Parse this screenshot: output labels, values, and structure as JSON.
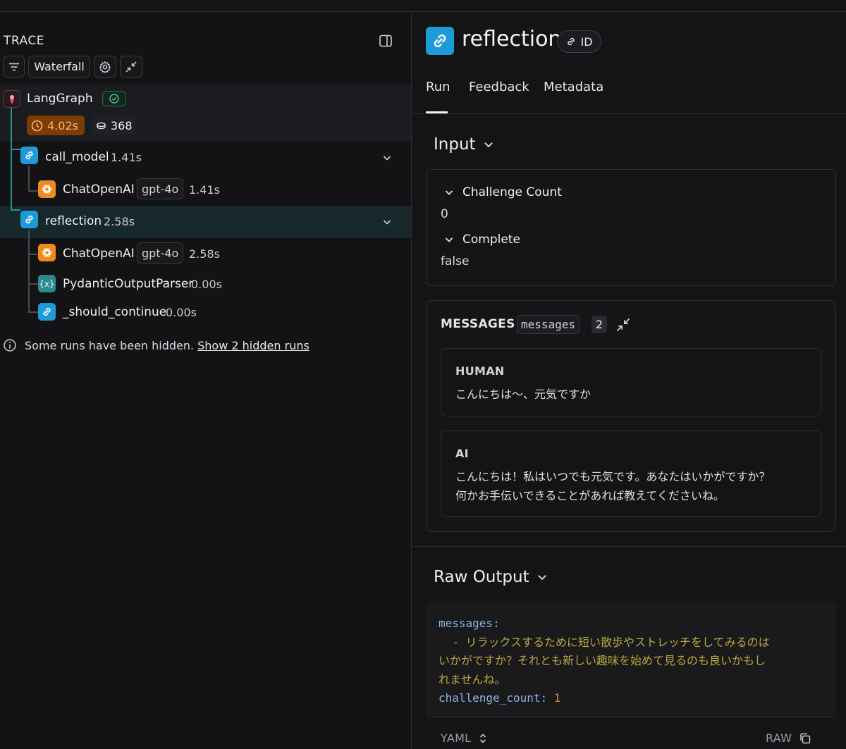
{
  "trace": {
    "title": "TRACE",
    "toolbar": {
      "view_label": "Waterfall"
    },
    "root": {
      "name": "LangGraph",
      "latency": "4.02s",
      "tokens": "368"
    },
    "runs": [
      {
        "name": "call_model",
        "duration": "1.41s"
      },
      {
        "name": "ChatOpenAI",
        "model": "gpt-4o",
        "duration": "1.41s"
      },
      {
        "name": "reflection",
        "duration": "2.58s"
      },
      {
        "name": "ChatOpenAI",
        "model": "gpt-4o",
        "duration": "2.58s"
      },
      {
        "name": "PydanticOutputParser",
        "duration": "0.00s"
      },
      {
        "name": "_should_continue",
        "duration": "0.00s"
      }
    ],
    "hidden_note": {
      "text": "Some runs have been hidden.",
      "link": "Show 2 hidden runs"
    }
  },
  "detail": {
    "title": "reflection",
    "id_label": "ID",
    "tabs": [
      "Run",
      "Feedback",
      "Metadata"
    ],
    "active_tab": "Run",
    "input": {
      "title": "Input",
      "fields": [
        {
          "label": "Challenge Count",
          "value": "0"
        },
        {
          "label": "Complete",
          "value": "false"
        }
      ],
      "messages": {
        "title": "MESSAGES",
        "key": "messages",
        "count": "2",
        "items": [
          {
            "role": "HUMAN",
            "lines": [
              "こんにちは〜、元気ですか"
            ]
          },
          {
            "role": "AI",
            "lines": [
              "こんにちは！私はいつでも元気です。あなたはいかがですか？",
              "何かお手伝いできることがあれば教えてくださいね。"
            ]
          }
        ]
      }
    },
    "raw_output": {
      "title": "Raw Output",
      "yaml_key_messages": "messages:",
      "yaml_dash": "  - ",
      "yaml_lines": [
        "リラックスするために短い散歩やストレッチをしてみるのは",
        "いかがですか？それとも新しい趣味を始めて見るのも良いかもし",
        "れませんね。"
      ],
      "yaml_key_count": "challenge_count:",
      "yaml_count_value": "1",
      "format_label": "YAML",
      "raw_label": "RAW"
    }
  },
  "colors": {
    "accent_blue": "#1e9bd7",
    "accent_orange": "#f08a1c",
    "latency_bg": "#7a3d06",
    "tree_line": "#2f8f95"
  }
}
